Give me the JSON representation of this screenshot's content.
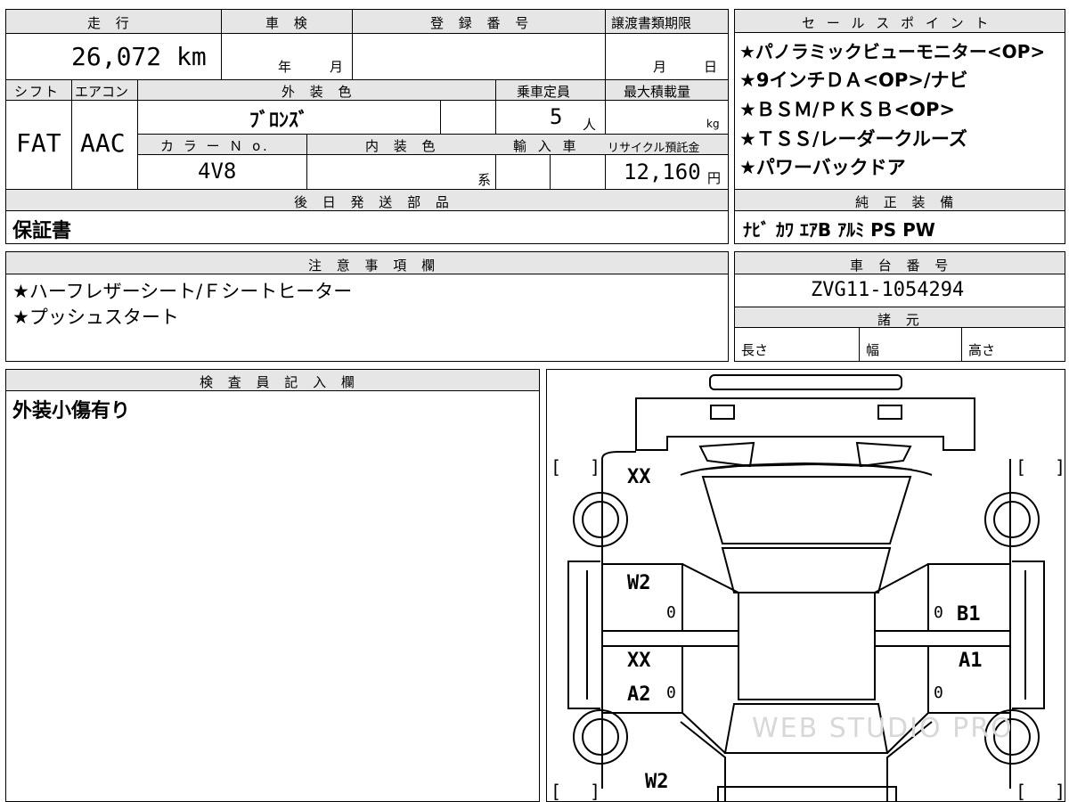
{
  "top": {
    "mileage_label": "走 行",
    "inspection_label": "車 検",
    "registration_label": "登 録 番 号",
    "transfer_deadline_label": "譲渡書類期限",
    "mileage_value": "26,072 km",
    "year_unit": "年",
    "month_unit": "月",
    "deadline_month_unit": "月",
    "deadline_day_unit": "日"
  },
  "specs": {
    "shift_label": "シフト",
    "aircon_label": "エアコン",
    "exterior_color_label": "外 装 色",
    "capacity_label": "乗車定員",
    "max_load_label": "最大積載量",
    "shift_value": "FAT",
    "aircon_value": "AAC",
    "exterior_color_value": "ﾌﾞﾛﾝｽﾞ",
    "capacity_value": "5",
    "capacity_unit": "人",
    "load_unit": "kg",
    "color_no_label": "カ ラ ー Ｎ o.",
    "interior_color_label": "内 装 色",
    "import_label": "輸 入 車",
    "recycle_label": "リサイクル預託金",
    "color_no_value": "4V8",
    "interior_suffix": "系",
    "recycle_value": "12,160",
    "recycle_unit": "円"
  },
  "later_parts": {
    "label": "後 日 発 送 部 品",
    "value": "保証書"
  },
  "notes": {
    "label": "注 意 事 項 欄",
    "lines": [
      "★ハーフレザーシート/Ｆシートヒーター",
      "★プッシュスタート"
    ]
  },
  "inspector": {
    "label": "検 査 員 記 入 欄",
    "text": "外装小傷有り"
  },
  "sales_points": {
    "label": "セ ー ル ス ポ イ ン ト",
    "lines": [
      "★パノラミックビューモニター<OP>",
      "★9インチＤＡ<OP>/ナビ",
      "★ＢＳＭ/ＰＫＳＢ<OP>",
      "★ＴＳＳ/レーダークルーズ",
      "★パワーバックドア"
    ]
  },
  "genuine_equipment": {
    "label": "純 正 装 備",
    "value": "ﾅﾋﾞ ｶﾜ ｴｱB ｱﾙﾐ PS PW"
  },
  "chassis": {
    "label": "車 台 番 号",
    "value": "ZVG11-1054294"
  },
  "dimensions": {
    "label": "諸 元",
    "length_label": "長さ",
    "width_label": "幅",
    "height_label": "高さ"
  },
  "diagram": {
    "marks": {
      "front_left_door": "XX",
      "left_front_door": "W2",
      "left_front_zero": "0",
      "right_front_zero": "0",
      "right_front_door": "B1",
      "left_rear_top": "XX",
      "left_rear_door": "A2",
      "left_rear_zero": "0",
      "right_rear_top": "A1",
      "right_rear_zero": "0",
      "rear_left": "W2"
    },
    "watermark": "WEB STUDIO PRO"
  }
}
